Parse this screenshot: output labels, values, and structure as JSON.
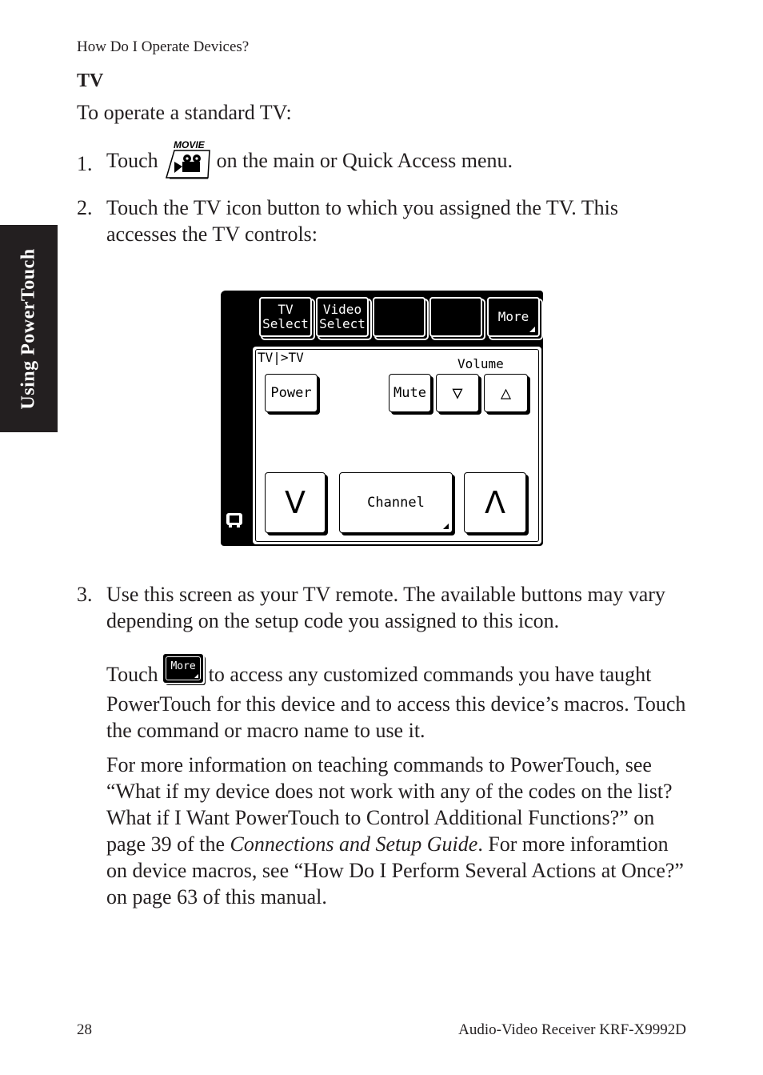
{
  "page": {
    "running_head": "How Do I Operate Devices?",
    "side_tab": "Using PowerTouch",
    "section_title": "TV",
    "intro": "To operate a standard TV:",
    "steps": [
      {
        "number": "1.",
        "before_icon": "Touch",
        "icon": "movie-icon",
        "icon_label": "MOVIE",
        "after_icon": "on the main or Quick Access menu."
      },
      {
        "number": "2.",
        "text": "Touch the TV icon button to which you assigned the TV. This accesses the TV controls:"
      },
      {
        "number": "3.",
        "text": "Use this screen as your TV remote. The available buttons may vary depending on the setup code you assigned to this icon.",
        "touch_para_before": "Touch",
        "touch_icon_label": "More",
        "touch_para_after": "to access any customized commands you have taught PowerTouch for this device and to access this device’s macros. Touch the command or macro name to use it.",
        "more_info_1": "For more information on teaching commands to PowerTouch, see “What if my device does not work with any of the codes on the list? What if I Want PowerTouch to Control Additional Functions?” on page 39 of the ",
        "more_info_italic": "Connections and Setup Guide",
        "more_info_2": ". For more inforamtion on device macros, see “How Do I Perform Several Actions at Once?” on page 63 of this manual."
      }
    ],
    "footer_page": "28",
    "footer_title": "Audio-Video Receiver KRF-X9992D"
  },
  "screen": {
    "top_buttons": [
      "TV\nSelect",
      "Video\nSelect",
      "",
      "",
      "More"
    ],
    "breadcrumb": "TV|>TV",
    "volume_label": "Volume",
    "power": "Power",
    "mute": "Mute",
    "vol_down": "▽",
    "vol_up": "△",
    "ch_down": "V",
    "channel": "Channel",
    "ch_up": "Λ",
    "device_icon": "tv-icon"
  }
}
